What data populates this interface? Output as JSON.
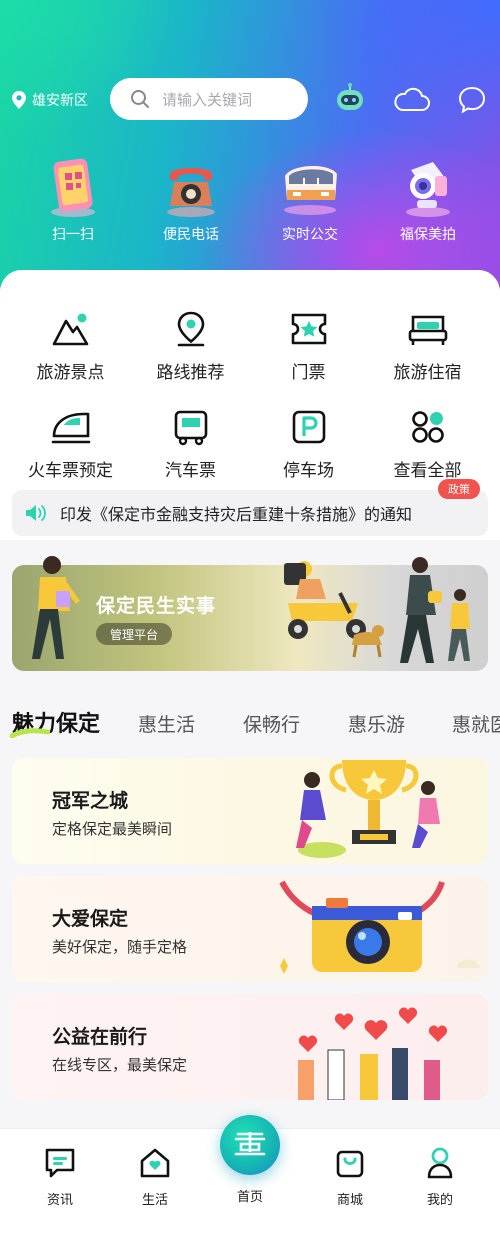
{
  "header": {
    "location": "雄安新区",
    "search_placeholder": "请输入关键词"
  },
  "quick_actions": [
    {
      "label": "扫一扫",
      "icon": "scan-icon"
    },
    {
      "label": "便民电话",
      "icon": "telephone-icon"
    },
    {
      "label": "实时公交",
      "icon": "bus-icon"
    },
    {
      "label": "福保美拍",
      "icon": "camera-icon"
    }
  ],
  "services": [
    {
      "label": "旅游景点",
      "icon": "mountain-icon"
    },
    {
      "label": "路线推荐",
      "icon": "route-pin-icon"
    },
    {
      "label": "门票",
      "icon": "ticket-icon"
    },
    {
      "label": "旅游住宿",
      "icon": "bed-icon"
    },
    {
      "label": "火车票预定",
      "icon": "train-icon"
    },
    {
      "label": "汽车票",
      "icon": "bus-ticket-icon"
    },
    {
      "label": "停车场",
      "icon": "parking-icon"
    },
    {
      "label": "查看全部",
      "icon": "grid-all-icon"
    }
  ],
  "notice": {
    "text": "印发《保定市金融支持灾后重建十条措施》的通知",
    "badge": "政策"
  },
  "banner": {
    "title": "保定民生实事",
    "button": "管理平台"
  },
  "tabs": [
    "魅力保定",
    "惠生活",
    "保畅行",
    "惠乐游",
    "惠就医"
  ],
  "cards": [
    {
      "title": "冠军之城",
      "subtitle": "定格保定最美瞬间"
    },
    {
      "title": "大爱保定",
      "subtitle": "美好保定，随手定格"
    },
    {
      "title": "公益在前行",
      "subtitle": "在线专区，最美保定"
    }
  ],
  "bottom_nav": [
    {
      "label": "资讯",
      "icon": "news-icon"
    },
    {
      "label": "生活",
      "icon": "home-heart-icon"
    },
    {
      "label": "首页",
      "icon": "hui-logo-icon"
    },
    {
      "label": "商城",
      "icon": "shopping-bag-icon"
    },
    {
      "label": "我的",
      "icon": "user-icon"
    }
  ],
  "colors": {
    "accent_teal": "#16b3b3",
    "policy_red": "#f0524d",
    "tab_highlight": "#b7e64a"
  }
}
